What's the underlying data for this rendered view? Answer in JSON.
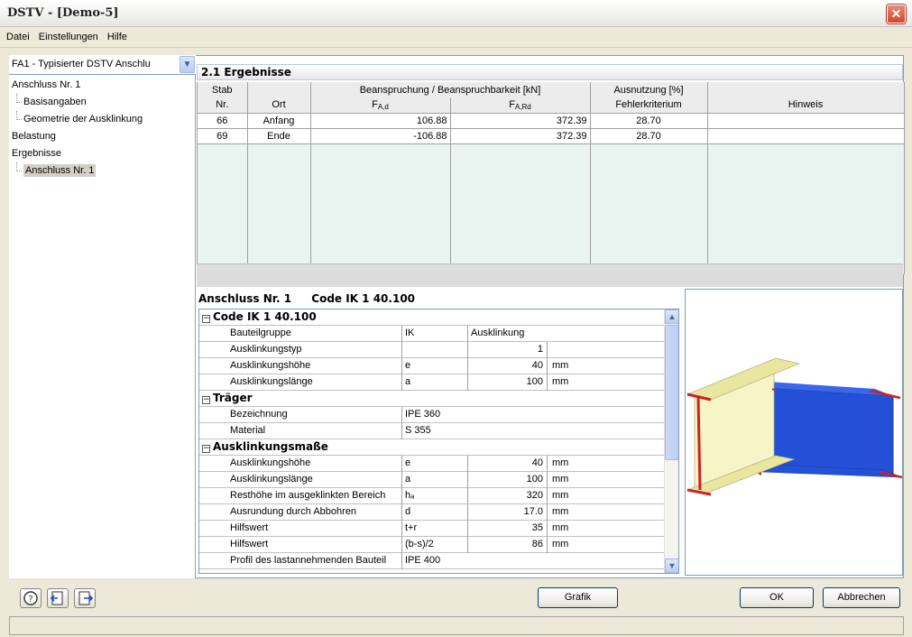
{
  "window": {
    "title": "DSTV - [Demo-5]"
  },
  "menu": [
    "Datei",
    "Einstellungen",
    "Hilfe"
  ],
  "connection_select": {
    "value": "FA1 - Typisierter DSTV Anschlu"
  },
  "tree": [
    {
      "label": "Anschluss Nr. 1",
      "level": 0
    },
    {
      "label": "Basisangaben",
      "level": 1
    },
    {
      "label": "Geometrie der Ausklinkung",
      "level": 1
    },
    {
      "label": "Belastung",
      "level": 0
    },
    {
      "label": "Ergebnisse",
      "level": 0
    },
    {
      "label": "Anschluss Nr. 1",
      "level": 1,
      "selected": true
    }
  ],
  "results": {
    "section_title": "2.1 Ergebnisse",
    "headers": {
      "stab_top": "Stab",
      "stab_bottom": "Nr.",
      "ort": "Ort",
      "group_title": "Beanspruchung / Beanspruchbarkeit [kN]",
      "fad_main": "F",
      "fad_sub": "A,d",
      "fard_main": "F",
      "fard_sub": "A,Rd",
      "ausnutzung_top": "Ausnutzung [%]",
      "ausnutzung_bottom": "Fehlerkriterium",
      "hinweis": "Hinweis"
    },
    "rows": [
      {
        "stab": "66",
        "ort": "Anfang",
        "fad": "106.88",
        "fard": "372.39",
        "ausnutzung": "28.70",
        "hinweis": ""
      },
      {
        "stab": "69",
        "ort": "Ende",
        "fad": "-106.88",
        "fard": "372.39",
        "ausnutzung": "28.70",
        "hinweis": ""
      }
    ]
  },
  "details": {
    "header_left": "Anschluss Nr. 1",
    "header_right": "Code IK 1 40.100",
    "groups": {
      "code": "Code IK 1 40.100",
      "traeger": "Träger",
      "ausklinkungsmasse": "Ausklinkungsmaße"
    },
    "code_rows": [
      {
        "label": "Bauteilgruppe",
        "symbol": "IK",
        "value": "Ausklinkung",
        "unit": "",
        "wide": true
      },
      {
        "label": "Ausklinkungstyp",
        "symbol": "",
        "value": "1",
        "unit": ""
      },
      {
        "label": "Ausklinkungshöhe",
        "symbol": "e",
        "value": "40",
        "unit": "mm"
      },
      {
        "label": "Ausklinkungslänge",
        "symbol": "a",
        "value": "100",
        "unit": "mm"
      }
    ],
    "traeger_rows": [
      {
        "label": "Bezeichnung",
        "symbol": "IPE 360"
      },
      {
        "label": "Material",
        "symbol": "S 355"
      }
    ],
    "mass_rows": [
      {
        "label": "Ausklinkungshöhe",
        "symbol": "e",
        "value": "40",
        "unit": "mm"
      },
      {
        "label": "Ausklinkungslänge",
        "symbol": "a",
        "value": "100",
        "unit": "mm"
      },
      {
        "label": "Resthöhe im ausgeklinkten Bereich",
        "symbol": "hₐ",
        "value": "320",
        "unit": "mm"
      },
      {
        "label": "Ausrundung durch Abbohren",
        "symbol": "d",
        "value": "17.0",
        "unit": "mm"
      },
      {
        "label": "Hilfswert",
        "symbol": "t+r",
        "value": "35",
        "unit": "mm"
      },
      {
        "label": "Hilfswert",
        "symbol": "(b-s)/2",
        "value": "86",
        "unit": "mm"
      },
      {
        "label": "Profil des lastannehmenden Bauteil",
        "symbol": "IPE 400",
        "value": "",
        "unit": ""
      }
    ]
  },
  "buttons": {
    "grafik": "Grafik",
    "ok": "OK",
    "cancel": "Abbrechen"
  },
  "colors": {
    "beam_flange": "#f2f0b4",
    "beam_web": "#f7f5c8",
    "connected_beam": "#2450d8",
    "section_edge": "#d02020"
  }
}
